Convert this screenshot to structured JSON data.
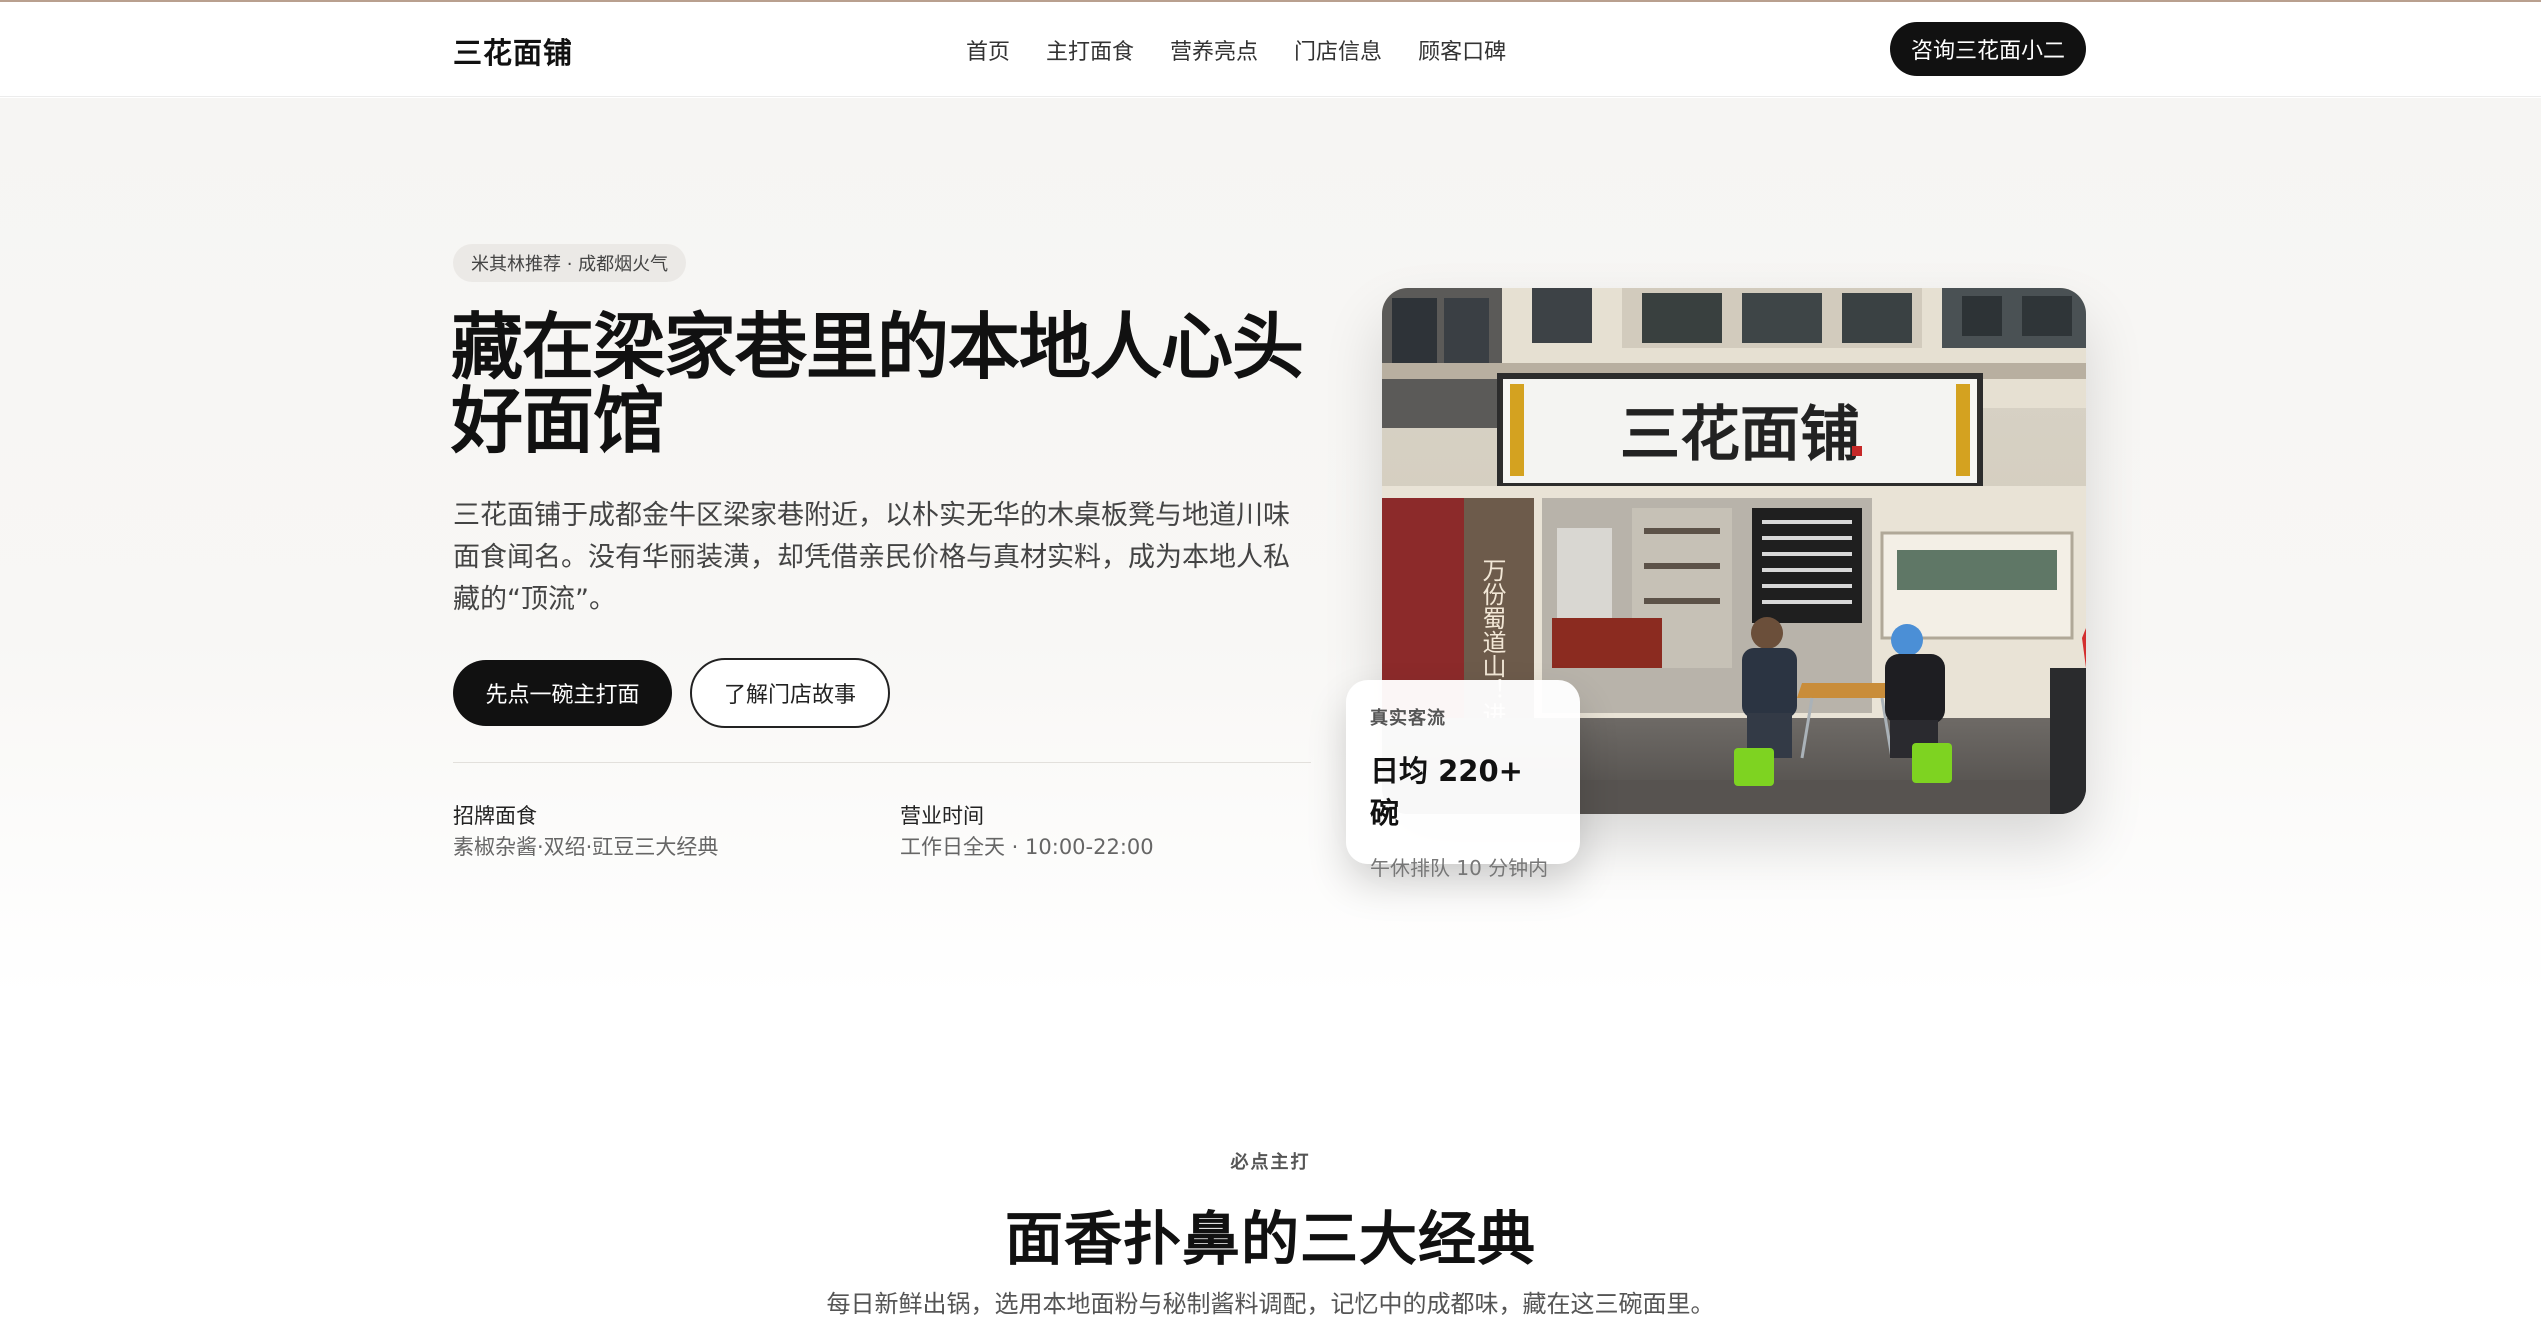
{
  "header": {
    "logo": "三花面铺",
    "nav": [
      "首页",
      "主打面食",
      "营养亮点",
      "门店信息",
      "顾客口碑"
    ],
    "cta": "咨询三花面小二"
  },
  "hero": {
    "badge": "米其林推荐 · 成都烟火气",
    "title": "藏在梁家巷里的本地人心头好面馆",
    "intro": "三花面铺于成都金牛区梁家巷附近，以朴实无华的木桌板凳与地道川味面食闻名。没有华丽装潢，却凭借亲民价格与真材实料，成为本地人私藏的“顶流”。",
    "primary_button": "先点一碗主打面",
    "secondary_button": "了解门店故事",
    "facts": [
      {
        "label": "招牌面食",
        "value": "素椒杂酱·双绍·豇豆三大经典"
      },
      {
        "label": "营业时间",
        "value": "工作日全天 · 10:00-22:00"
      }
    ],
    "photo_sign": "三花面铺",
    "photo_side_sign": "万份蜀道山！进来",
    "stat_card": {
      "label": "真实客流",
      "value": "日均 220+ 碗",
      "note": "午休排队 10 分钟内"
    }
  },
  "signature": {
    "eyebrow": "必点主打",
    "title": "面香扑鼻的三大经典",
    "subtitle": "每日新鲜出锅，选用本地面粉与秘制酱料调配，记忆中的成都味，藏在这三碗面里。"
  },
  "colors": {
    "accent": "#111111",
    "hero_background": "#f6f5f3",
    "badge_background": "#ebe9e6",
    "stool_green": "#7ed321"
  }
}
